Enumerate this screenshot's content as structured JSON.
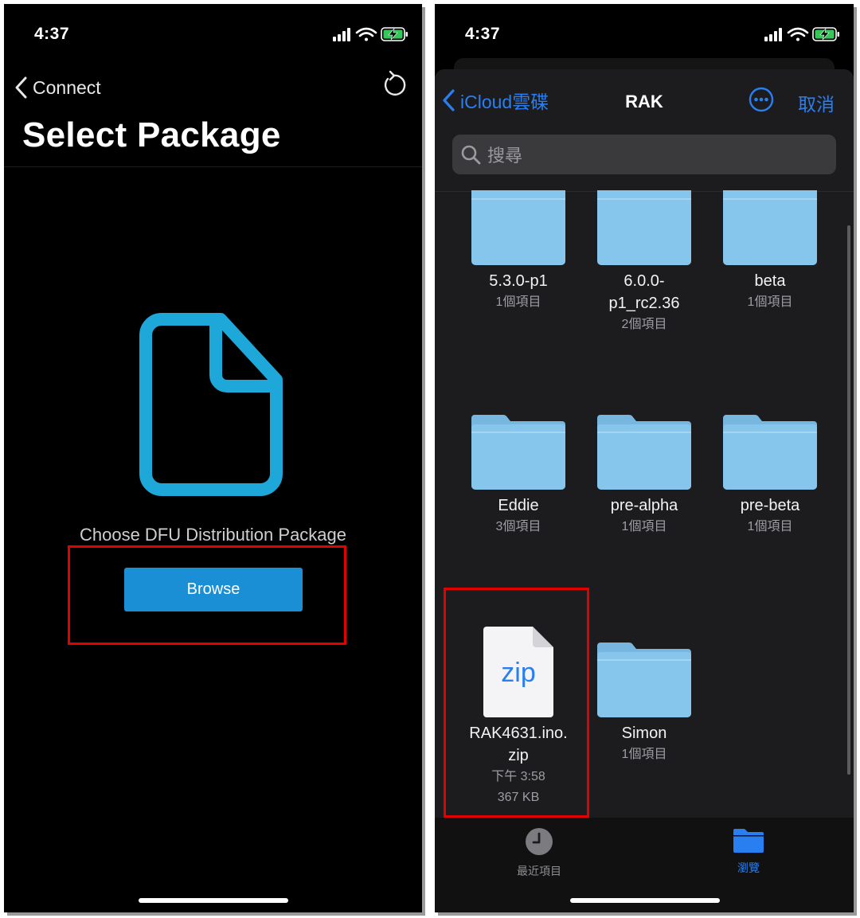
{
  "left": {
    "status": {
      "time": "4:37"
    },
    "nav": {
      "back_label": "Connect"
    },
    "title": "Select Package",
    "prompt": "Choose DFU Distribution Package",
    "browse_label": "Browse"
  },
  "right": {
    "status": {
      "time": "4:37"
    },
    "header": {
      "back_label": "iCloud雲碟",
      "title": "RAK",
      "cancel_label": "取消"
    },
    "search": {
      "placeholder": "搜尋"
    },
    "items": [
      {
        "name": "5.3.0-p1",
        "meta": "1個項目",
        "type": "folder"
      },
      {
        "name": "6.0.0-p1_rc2.36",
        "name_line1": "6.0.0-",
        "name_line2": "p1_rc2.36",
        "meta": "2個項目",
        "type": "folder"
      },
      {
        "name": "beta",
        "meta": "1個項目",
        "type": "folder"
      },
      {
        "name": "Eddie",
        "meta": "3個項目",
        "type": "folder"
      },
      {
        "name": "pre-alpha",
        "meta": "1個項目",
        "type": "folder"
      },
      {
        "name": "pre-beta",
        "meta": "1個項目",
        "type": "folder"
      },
      {
        "name": "RAK4631.ino.zip",
        "name_line1": "RAK4631.ino.",
        "name_line2": "zip",
        "meta": "下午 3:58",
        "size": "367 KB",
        "type": "zip",
        "icon_text": "zip"
      },
      {
        "name": "Simon",
        "meta": "1個項目",
        "type": "folder"
      }
    ],
    "tabs": [
      {
        "label": "最近項目",
        "icon": "clock-icon",
        "active": false
      },
      {
        "label": "瀏覽",
        "icon": "folder-icon",
        "active": true
      }
    ]
  },
  "colors": {
    "accent": "#2a7ff0",
    "browse_button": "#1a8fd6",
    "doc_icon": "#1ea7d9",
    "highlight": "#e30000",
    "folder": "#86c6ec"
  }
}
